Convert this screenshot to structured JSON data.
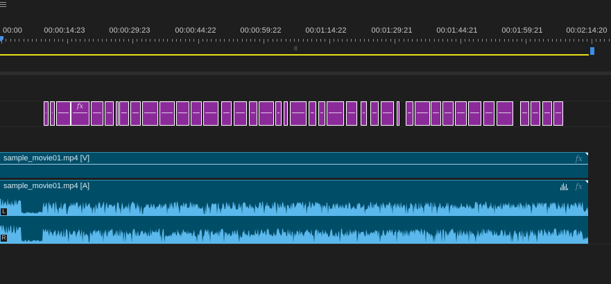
{
  "timeline": {
    "menu_icon": "hamburger-icon",
    "timecodes": [
      "00:00",
      "00:00:14:23",
      "00:00:29:23",
      "00:00:44:22",
      "00:00:59:22",
      "00:01:14:22",
      "00:01:29:21",
      "00:01:44:21",
      "00:01:59:21",
      "00:02:14:20"
    ],
    "colors": {
      "work_area": "#e8e015",
      "playhead": "#4a90e2",
      "clip_purple": "#8b2b9a",
      "clip_teal": "#004d68",
      "waveform": "#5bb8ec"
    }
  },
  "video_clip": {
    "name": "sample_movie01.mp4 [V]",
    "fx": "fx"
  },
  "audio_clip": {
    "name": "sample_movie01.mp4 [A]",
    "fx": "fx",
    "left_label": "L",
    "right_label": "R"
  },
  "fx_clip_label": "fx"
}
